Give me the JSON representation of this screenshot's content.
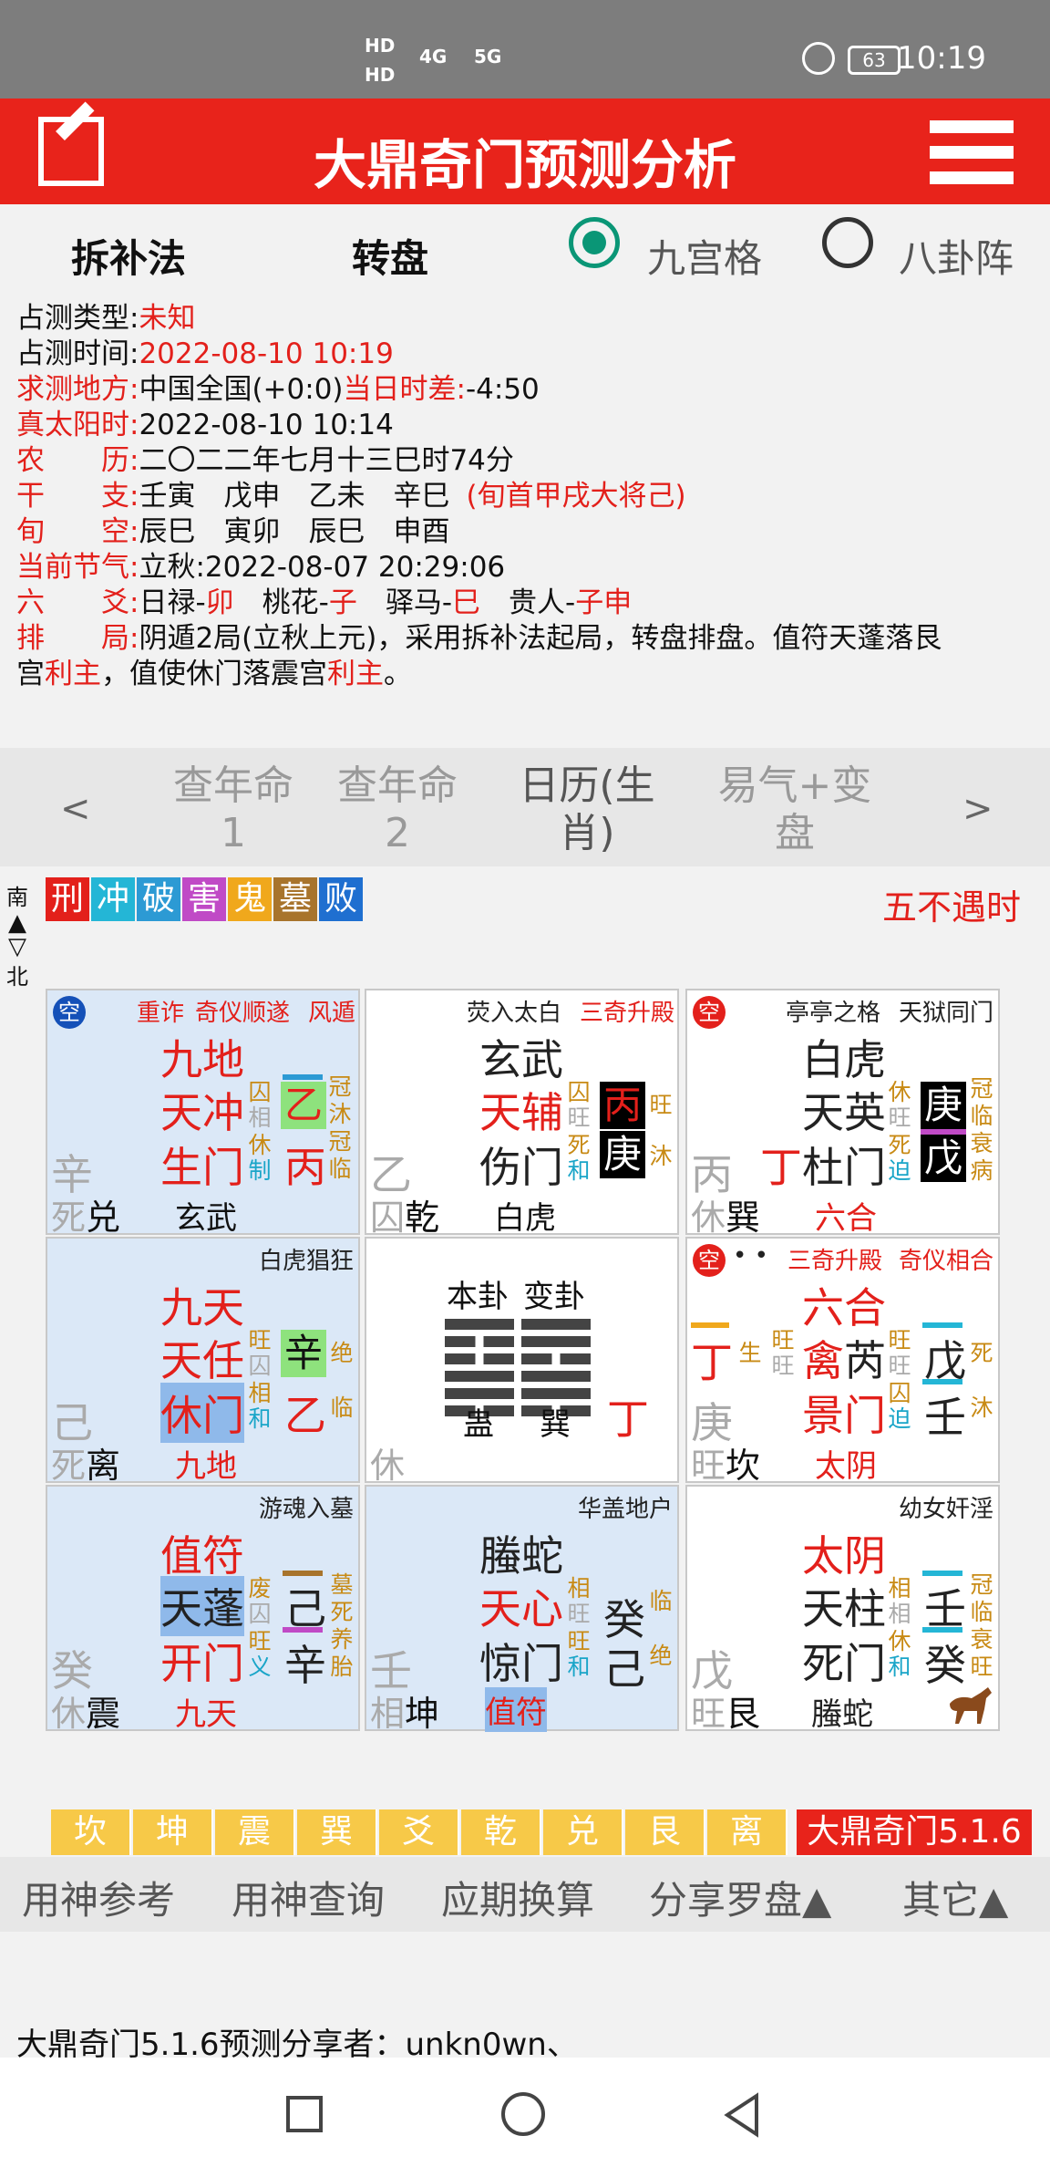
{
  "status": {
    "sig1": "HD",
    "sig2": "4G",
    "sig3": "5G",
    "battery": "63",
    "time": "10:19"
  },
  "header": {
    "title": "大鼎奇门预测分析",
    "icons": [
      "edit-icon",
      "menu-icon"
    ]
  },
  "options": {
    "method": "拆补法",
    "rotate": "转盘",
    "radio1": "九宫格",
    "radio2": "八卦阵"
  },
  "info": {
    "l1": "占测类型:",
    "v1": "未知",
    "l2": "占测时间:",
    "v2": "2022-08-10 10:19",
    "l3": "求测地方:",
    "v3a": "中国全国(+0:0)",
    "v3b": "当日时差:",
    "v3c": "-4:50",
    "l4": "真太阳时:",
    "v4": "2022-08-10 10:14",
    "l5": "农　　历:",
    "v5": "二〇二二年七月十三巳时74分",
    "l6": "干　　支:",
    "v6": "壬寅　戊申　乙未　辛巳",
    "v6b": "(旬首甲戌大将己)",
    "l7": "旬　　空:",
    "v7": "辰巳　寅卯　辰巳　申酉",
    "l8": "当前节气:",
    "v8": "立秋:2022-08-07 20:29:06",
    "l9": "六　　爻:",
    "v9a": "日禄-",
    "v9b": "卯",
    "v9c": "　桃花-",
    "v9d": "子",
    "v9e": "　驿马-",
    "v9f": "巳",
    "v9g": "　贵人-",
    "v9h": "子申",
    "l10": "排　　局:",
    "v10a": "阴遁2局(立秋上元)，采用拆补法起局，转盘排盘。值符天蓬落艮",
    "v10b": "宫",
    "v10c": "利主",
    "v10d": "，值使休门落震宫",
    "v10e": "利主",
    "v10f": "。"
  },
  "tabs": {
    "left": "<",
    "t1a": "查年命",
    "t1b": "1",
    "t2a": "查年命",
    "t2b": "2",
    "t3a": "日历(生",
    "t3b": "肖)",
    "t4a": "易气+变",
    "t4b": "盘",
    "right": ">"
  },
  "compass": {
    "south": "南",
    "north": "北"
  },
  "legend": [
    {
      "t": "刑",
      "c": "#e3201b"
    },
    {
      "t": "冲",
      "c": "#24b6d6"
    },
    {
      "t": "破",
      "c": "#2c9ad4"
    },
    {
      "t": "害",
      "c": "#c04ac6"
    },
    {
      "t": "鬼",
      "c": "#f0a81c"
    },
    {
      "t": "墓",
      "c": "#a8742c"
    },
    {
      "t": "败",
      "c": "#1f6fd0"
    }
  ],
  "wubuyu": "五不遇时",
  "cells": {
    "xun": {
      "top1": "重诈",
      "top2": "奇仪顺遂",
      "top3": "风遁",
      "god": "九地",
      "star": "天冲",
      "door": "生门",
      "s1": "囚",
      "s2": "相",
      "s3": "休",
      "s4": "制",
      "gan1": "乙",
      "gan2": "丙",
      "c1": "冠",
      "c2": "沐",
      "c3": "冠",
      "c4": "临",
      "left": "辛",
      "bot1": "死",
      "bot2": "兑",
      "deity": "玄武"
    },
    "li": {
      "top1": "荧入太白",
      "top2": "三奇升殿",
      "god": "玄武",
      "star": "天辅",
      "door": "伤门",
      "s1": "囚",
      "s2": "旺",
      "s3": "死",
      "s4": "和",
      "gan1": "丙",
      "gan2": "庚",
      "c1": "旺",
      "c2": "沐",
      "left": "乙",
      "bot1": "囚",
      "bot2": "乾",
      "deity": "白虎"
    },
    "kun": {
      "top1": "亭亭之格",
      "top2": "天狱同门",
      "god": "白虎",
      "star": "天英",
      "door": "杜门",
      "pre": "丁",
      "s1": "休",
      "s2": "旺",
      "s3": "死",
      "s4": "迫",
      "gan1": "庚",
      "gan2": "戊",
      "c1": "冠",
      "c2": "临",
      "c3": "衰",
      "c4": "病",
      "left": "丙",
      "bot1": "休",
      "bot2": "巽",
      "deity": "六合"
    },
    "zhen": {
      "top1": "白虎猖狂",
      "god": "九天",
      "star": "天任",
      "door": "休门",
      "s1": "旺",
      "s2": "囚",
      "s3": "相",
      "s4": "和",
      "gan1": "辛",
      "gan2": "乙",
      "c1": "绝",
      "c2": "临",
      "left": "己",
      "bot1": "死",
      "bot2": "离",
      "deity": "九地"
    },
    "zhong": {
      "h1": "本卦",
      "h2": "变卦",
      "g1": "蛊",
      "g2": "巽",
      "gan": "丁",
      "left": "休"
    },
    "dui": {
      "dots": "• •",
      "top1": "三奇升殿",
      "top2": "奇仪相合",
      "god": "六合",
      "star": "禽",
      "star2": "芮",
      "door": "景门",
      "pre": "丁",
      "pre2": "生",
      "s0": "旺",
      "s00": "旺",
      "s1": "旺",
      "s2": "旺",
      "s3": "囚",
      "s4": "迫",
      "gan1": "戊",
      "gan2": "壬",
      "c1": "死",
      "c2": "沐",
      "left": "庚",
      "bot1": "旺",
      "bot2": "坎",
      "deity": "太阴"
    },
    "gen": {
      "top1": "游魂入墓",
      "god": "值符",
      "star": "天蓬",
      "door": "开门",
      "s1": "废",
      "s2": "囚",
      "s3": "旺",
      "s4": "义",
      "gan1": "己",
      "gan2": "辛",
      "c1": "墓",
      "c2": "死",
      "c3": "养",
      "c4": "胎",
      "left": "癸",
      "bot1": "休",
      "bot2": "震",
      "deity": "九天"
    },
    "kan": {
      "top1": "华盖地户",
      "god": "螣蛇",
      "star": "天心",
      "door": "惊门",
      "s1": "相",
      "s2": "旺",
      "s3": "旺",
      "s4": "和",
      "gan1": "癸",
      "gan2": "己",
      "c1": "临",
      "c2": "绝",
      "left": "壬",
      "bot1": "相",
      "bot2": "坤",
      "deity": "值符"
    },
    "qian": {
      "top1": "幼女奸淫",
      "god": "太阴",
      "star": "天柱",
      "door": "死门",
      "s1": "相",
      "s2": "相",
      "s3": "休",
      "s4": "和",
      "gan1": "壬",
      "gan2": "癸",
      "c1": "冠",
      "c2": "临",
      "c3": "衰",
      "c4": "旺",
      "left": "戊",
      "bot1": "旺",
      "bot2": "艮",
      "deity": "螣蛇"
    }
  },
  "bagua": [
    "坎",
    "坤",
    "震",
    "巽",
    "爻",
    "乾",
    "兑",
    "艮",
    "离"
  ],
  "version": "大鼎奇门5.1.6",
  "bottomnav": [
    "用神参考",
    "用神查询",
    "应期换算",
    "分享罗盘▲",
    "其它▲"
  ],
  "share": "大鼎奇门5.1.6预测分享者：unkn0wn、",
  "colors": {
    "red": "#e8231b",
    "green": "#0a9676",
    "blue_cell": "#dbe8f7"
  }
}
